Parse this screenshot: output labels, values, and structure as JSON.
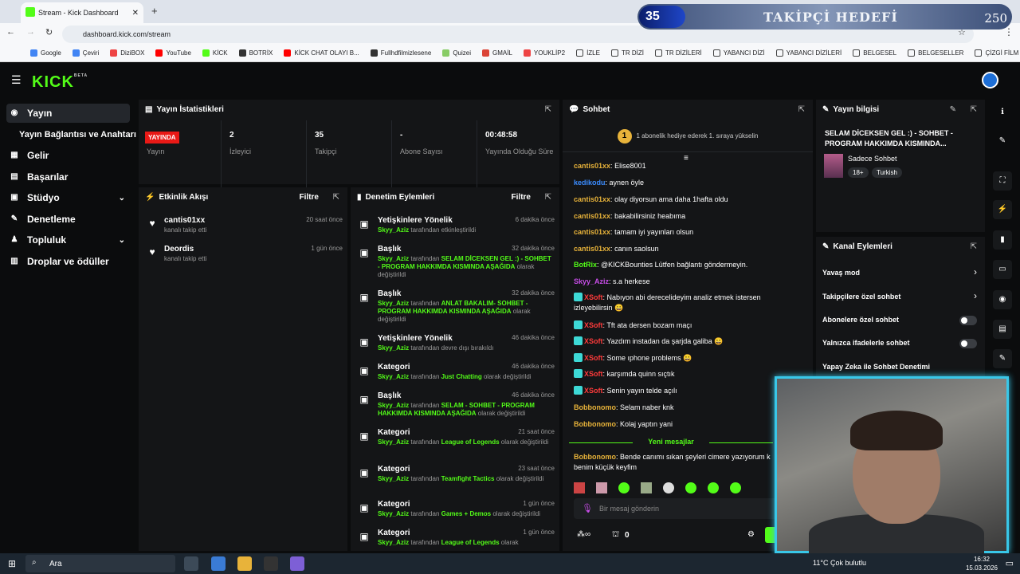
{
  "browser": {
    "tab_title": "Stream - Kick Dashboard",
    "url": "dashboard.kick.com/stream",
    "bookmarks": [
      "Google",
      "Çeviri",
      "DiziBOX",
      "YouTube",
      "KİCK",
      "BOTRİX",
      "KİCK CHAT OLAYI B...",
      "Fullhdfilmizlesene",
      "Quizei",
      "GMAİL",
      "YOUKLİP2",
      "İZLE",
      "TR DİZİ",
      "TR DİZİLERİ",
      "YABANCI DİZİ",
      "YABANCI DİZİLERİ",
      "BELGESEL",
      "BELGESELLER",
      "ÇİZGİ FİLM"
    ]
  },
  "overlay": {
    "goal_current": "35",
    "goal_title": "TAKİPÇİ HEDEFİ",
    "goal_max": "250"
  },
  "sidebar": {
    "items": [
      "Yayın",
      "Yayın Bağlantısı ve Anahtarı",
      "Gelir",
      "Başarılar",
      "Stüdyo",
      "Denetleme",
      "Topluluk",
      "Droplar ve ödüller"
    ]
  },
  "stats": {
    "title": "Yayın İstatistikleri",
    "live_badge": "YAYINDA",
    "live_label": "Yayın",
    "viewers_value": "2",
    "viewers_label": "İzleyici",
    "followers_value": "35",
    "followers_label": "Takipçi",
    "subs_value": "-",
    "subs_label": "Abone Sayısı",
    "duration_value": "00:48:58",
    "duration_label": "Yayında Olduğu Süre"
  },
  "activity": {
    "title": "Etkinlik Akışı",
    "filter": "Filtre",
    "events": [
      {
        "name": "cantis01xx",
        "sub": "kanalı takip etti",
        "time": "20 saat önce"
      },
      {
        "name": "Deordis",
        "sub": "kanalı takip etti",
        "time": "1 gün önce"
      }
    ]
  },
  "moderation": {
    "title": "Denetim Eylemleri",
    "filter": "Filtre",
    "actions": [
      {
        "title": "Yetişkinlere Yönelik",
        "time": "6 dakika önce",
        "user": "Skyy_Aziz",
        "pre": "tarafından etkinleştirildi",
        "value": "",
        "post": ""
      },
      {
        "title": "Başlık",
        "time": "32 dakika önce",
        "user": "Skyy_Aziz",
        "pre": "tarafından",
        "value": "SELAM DİCEKSEN GEL :) - SOHBET - PROGRAM HAKKIMDA KISMINDA AŞAĞIDA",
        "post": "olarak değiştirildi"
      },
      {
        "title": "Başlık",
        "time": "32 dakika önce",
        "user": "Skyy_Aziz",
        "pre": "tarafından",
        "value": "ANLAT BAKALIM- SOHBET - PROGRAM HAKKIMDA KISMINDA AŞAĞIDA",
        "post": "olarak değiştirildi"
      },
      {
        "title": "Yetişkinlere Yönelik",
        "time": "46 dakika önce",
        "user": "Skyy_Aziz",
        "pre": "tarafından devre dışı bırakıldı",
        "value": "",
        "post": ""
      },
      {
        "title": "Kategori",
        "time": "46 dakika önce",
        "user": "Skyy_Aziz",
        "pre": "tarafından",
        "value": "Just Chatting",
        "post": "olarak değiştirildi"
      },
      {
        "title": "Başlık",
        "time": "46 dakika önce",
        "user": "Skyy_Aziz",
        "pre": "tarafından",
        "value": "SELAM - SOHBET - PROGRAM HAKKIMDA KISMINDA AŞAĞIDA",
        "post": "olarak değiştirildi"
      },
      {
        "title": "Kategori",
        "time": "21 saat önce",
        "user": "Skyy_Aziz",
        "pre": "tarafından",
        "value": "League of Legends",
        "post": "olarak değiştirildi"
      },
      {
        "title": "Kategori",
        "time": "23 saat önce",
        "user": "Skyy_Aziz",
        "pre": "tarafından",
        "value": "Teamfight Tactics",
        "post": "olarak değiştirildi"
      },
      {
        "title": "Kategori",
        "time": "1 gün önce",
        "user": "Skyy_Aziz",
        "pre": "tarafından",
        "value": "Games + Demos",
        "post": "olarak değiştirildi"
      },
      {
        "title": "Kategori",
        "time": "1 gün önce",
        "user": "Skyy_Aziz",
        "pre": "tarafından",
        "value": "League of Legends",
        "post": "olarak"
      }
    ]
  },
  "chat": {
    "title": "Sohbet",
    "pinned": "1 abonelik hediye ederek 1. sıraya yükselin",
    "pinned_rank": "1",
    "messages": [
      {
        "user": "cantis01xx",
        "color": "#e8b33a",
        "text": "Elise8001"
      },
      {
        "user": "kedikodu",
        "color": "#3b8cff",
        "text": "aynen öyle"
      },
      {
        "user": "cantis01xx",
        "color": "#e8b33a",
        "text": "olay diyorsun ama daha 1hafta oldu"
      },
      {
        "user": "cantis01xx",
        "color": "#e8b33a",
        "text": "bakabilirsiniz heabıma"
      },
      {
        "user": "cantis01xx",
        "color": "#e8b33a",
        "text": "tamam iyi yayınları olsun"
      },
      {
        "user": "cantis01xx",
        "color": "#e8b33a",
        "text": "canın saolsun"
      },
      {
        "user": "BotRix",
        "color": "#53fc18",
        "text": "@KICKBounties Lütfen bağlantı göndermeyin."
      },
      {
        "user": "Skyy_Aziz",
        "color": "#c84de8",
        "text": "s.a herkese"
      },
      {
        "user": "XSoft",
        "color": "#ff3b3b",
        "text": "Nabıyon abi derecelideyim analiz etmek istersen izleyebilirsin 😀"
      },
      {
        "user": "XSoft",
        "color": "#ff3b3b",
        "text": "Tft ata dersen bozam maçı"
      },
      {
        "user": "XSoft",
        "color": "#ff3b3b",
        "text": "Yazdım instadan da şarjda galiba 😀"
      },
      {
        "user": "XSoft",
        "color": "#ff3b3b",
        "text": "Some ıphone problems 😀"
      },
      {
        "user": "XSoft",
        "color": "#ff3b3b",
        "text": "karşımda quinn sıçtık"
      },
      {
        "user": "XSoft",
        "color": "#ff3b3b",
        "text": "Senin yayın telde açılı"
      },
      {
        "user": "Bobbonomo",
        "color": "#e8b33a",
        "text": "Selam naber knk"
      },
      {
        "user": "Bobbonomo",
        "color": "#e8b33a",
        "text": "Kolaj yaptın yani"
      }
    ],
    "new_messages_label": "Yeni mesajlar",
    "latest": {
      "user": "Bobbonomo",
      "color": "#e8b33a",
      "text": "Bende canımı sıkan şeyleri cimere yazıyorum k benim küçük keyfim"
    },
    "input_placeholder": "Bir mesaj gönderin",
    "footer_count": "0"
  },
  "stream_info": {
    "title": "Yayın bilgisi",
    "stream_title": "SELAM DİCEKSEN GEL :) - SOHBET - PROGRAM HAKKIMDA KISMINDA...",
    "category": "Sadece Sohbet",
    "tag_age": "18+",
    "tag_lang": "Turkish"
  },
  "channel_actions": {
    "title": "Kanal Eylemleri",
    "slow_mode": "Yavaş mod",
    "followers_only": "Takipçilere özel sohbet",
    "subs_only": "Abonelere özel sohbet",
    "emotes_only": "Yalnızca ifadelerle sohbet",
    "ai_mod": "Yapay Zeka ile Sohbet Denetimi"
  },
  "taskbar": {
    "search": "Ara",
    "weather": "11°C  Çok bulutlu",
    "time": "16:32",
    "date": "15.03.2026"
  },
  "colors": {
    "accent": "#53fc18",
    "panel": "#141517",
    "background": "#0b0c0d",
    "live": "#e91916"
  }
}
